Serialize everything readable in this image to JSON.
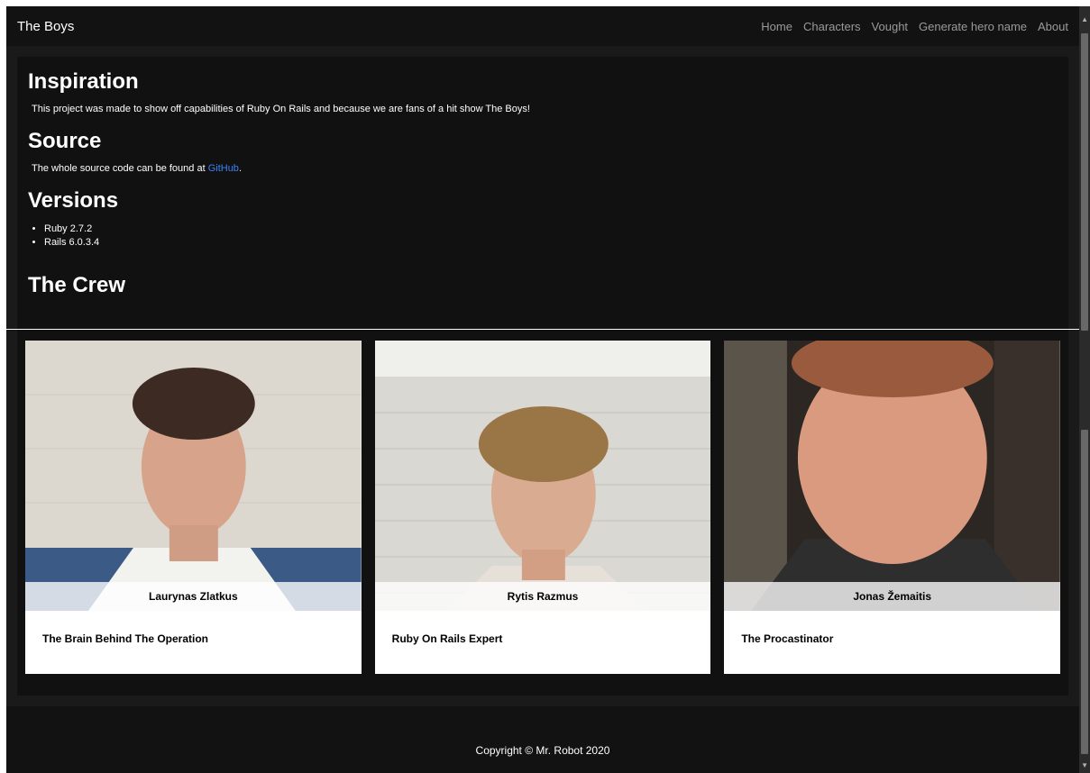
{
  "navbar": {
    "brand": "The Boys",
    "links": [
      "Home",
      "Characters",
      "Vought",
      "Generate hero name",
      "About"
    ]
  },
  "sections": {
    "inspiration_title": "Inspiration",
    "inspiration_text": "This project was made to show off capabilities of Ruby On Rails and because we are fans of a hit show The Boys!",
    "source_title": "Source",
    "source_text_prefix": "The whole source code can be found at ",
    "source_link": "GitHub",
    "source_text_suffix": ".",
    "versions_title": "Versions",
    "versions": [
      "Ruby 2.7.2",
      "Rails 6.0.3.4"
    ],
    "crew_title": "The Crew"
  },
  "crew": [
    {
      "name": "Laurynas Zlatkus",
      "role": "The Brain Behind The Operation"
    },
    {
      "name": "Rytis Razmus",
      "role": "Ruby On Rails Expert"
    },
    {
      "name": "Jonas Žemaitis",
      "role": "The Procastinator"
    }
  ],
  "footer": {
    "text": "Copyright © Mr. Robot 2020"
  }
}
